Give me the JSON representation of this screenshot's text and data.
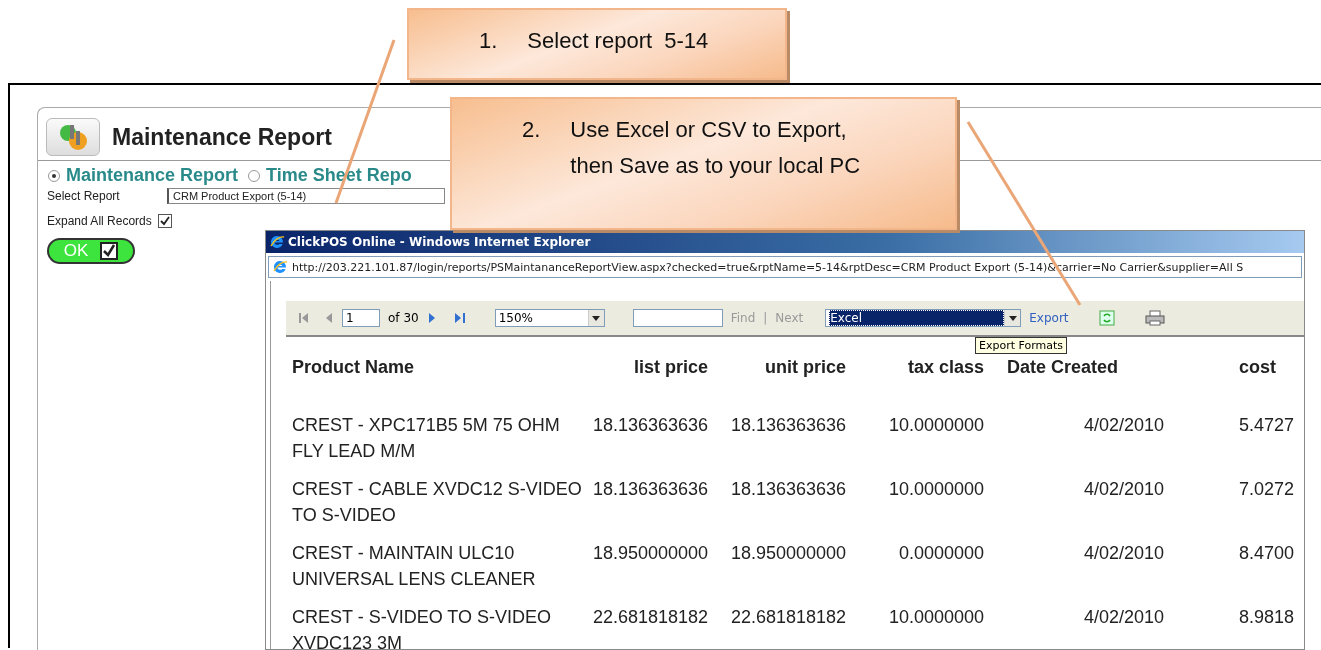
{
  "callouts": [
    {
      "number": "1.",
      "lines": [
        "Select report  5-14"
      ]
    },
    {
      "number": "2.",
      "lines": [
        "Use Excel or CSV to Export,",
        "then Save as to your local PC"
      ]
    }
  ],
  "report_panel": {
    "title": "Maintenance Report",
    "report_types": [
      {
        "label": "Maintenance Report",
        "selected": true
      },
      {
        "label": "Time Sheet Repo",
        "selected": false
      }
    ],
    "select_report": {
      "label": "Select Report",
      "value": "CRM Product Export (5-14)"
    },
    "expand_all": {
      "label": "Expand All Records",
      "checked": true
    },
    "ok_button": {
      "label": "OK"
    }
  },
  "browser": {
    "title": "ClickPOS Online - Windows Internet Explorer",
    "address": "http://203.221.101.87/login/reports/PSMaintananceReportView.aspx?checked=true&rptName=5-14&rptDesc=CRM Product Export (5-14)&carrier=No Carrier&supplier=All S",
    "toolbar": {
      "page": "1",
      "page_count": "of 30",
      "zoom": "150%",
      "find": "Find",
      "separator": "|",
      "next": "Next",
      "export_format": "Excel",
      "export": "Export",
      "tooltip": "Export Formats"
    },
    "table": {
      "columns": [
        "Product Name",
        "list price",
        "unit price",
        "tax class",
        "Date Created",
        "cost"
      ],
      "rows": [
        [
          "CREST - XPC171B5 5M 75 OHM FLY LEAD M/M",
          "18.136363636",
          "18.136363636",
          "10.0000000",
          "4/02/2010",
          "5.4727"
        ],
        [
          "CREST - CABLE XVDC12 S-VIDEO TO S-VIDEO",
          "18.136363636",
          "18.136363636",
          "10.0000000",
          "4/02/2010",
          "7.0272"
        ],
        [
          "CREST - MAINTAIN ULC10 UNIVERSAL LENS CLEANER",
          "18.950000000",
          "18.950000000",
          "0.0000000",
          "4/02/2010",
          "8.4700"
        ],
        [
          "CREST - S-VIDEO TO S-VIDEO XVDC123 3M",
          "22.681818182",
          "22.681818182",
          "10.0000000",
          "4/02/2010",
          "8.9818"
        ]
      ]
    }
  }
}
